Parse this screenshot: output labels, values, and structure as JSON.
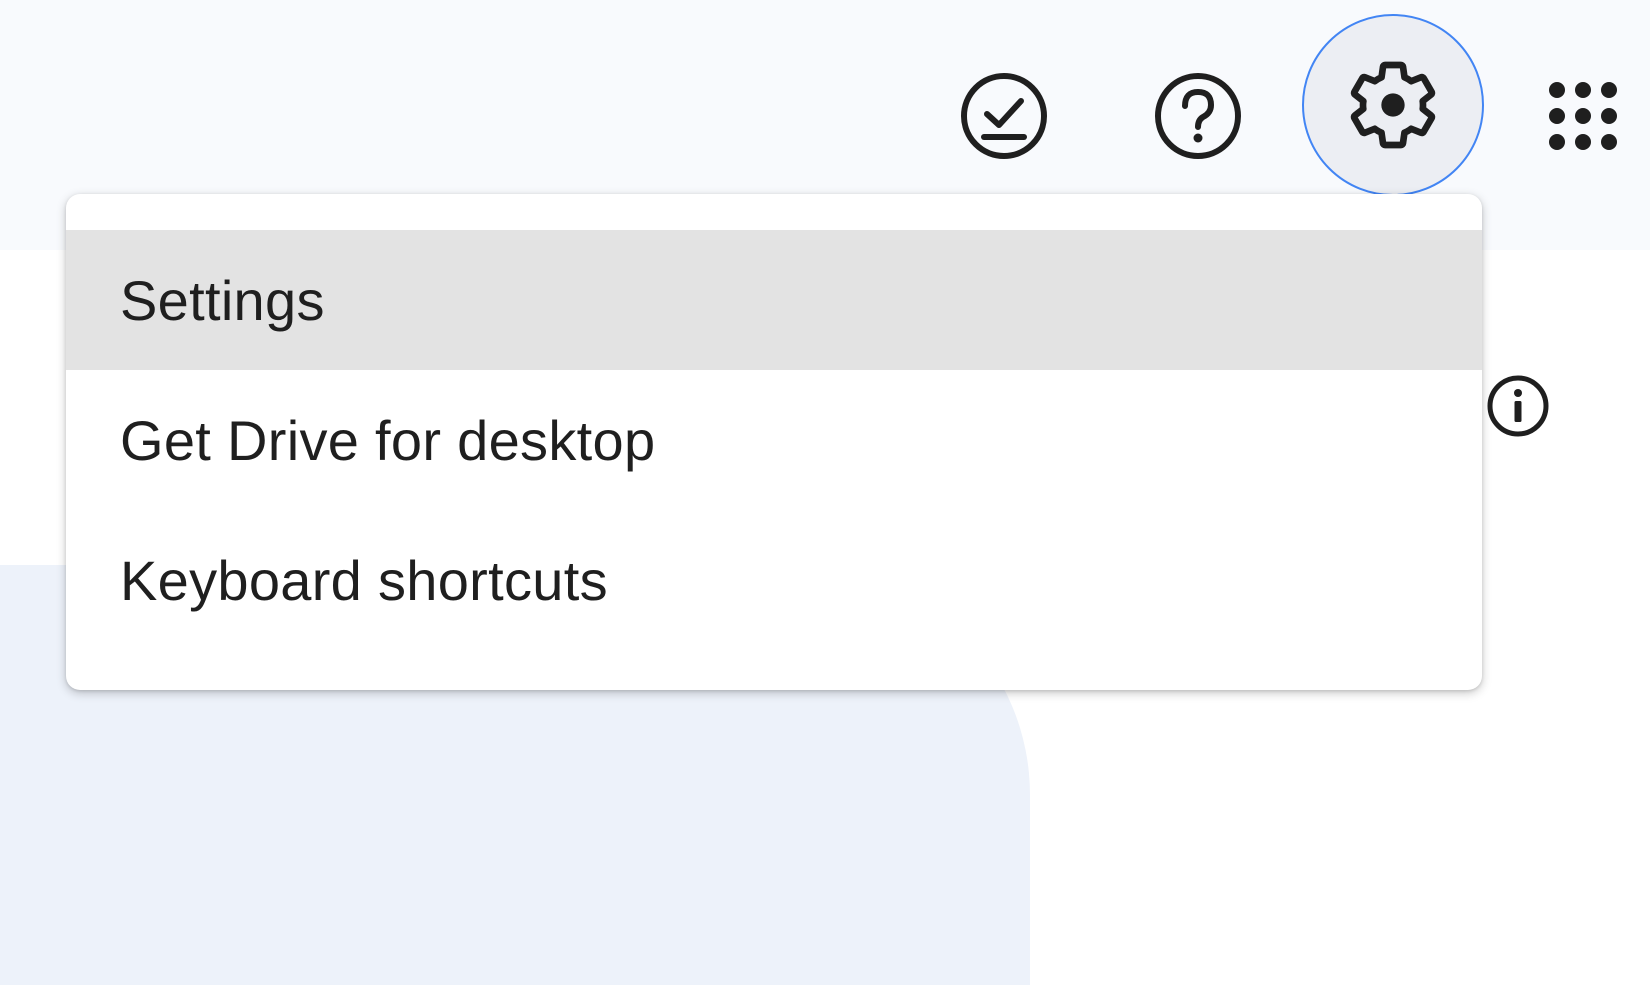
{
  "header": {
    "icons": {
      "offline": "offline-ready-icon",
      "help": "help-icon",
      "settings": "gear-icon",
      "apps": "apps-grid-icon"
    }
  },
  "settings_menu": {
    "items": [
      {
        "label": "Settings",
        "highlighted": true
      },
      {
        "label": "Get Drive for desktop",
        "highlighted": false
      },
      {
        "label": "Keyboard shortcuts",
        "highlighted": false
      }
    ]
  },
  "colors": {
    "focus_ring": "#4285f4",
    "highlight": "#e3e3e3",
    "header_bg": "#f8fafd",
    "text": "#1f1f1f"
  }
}
